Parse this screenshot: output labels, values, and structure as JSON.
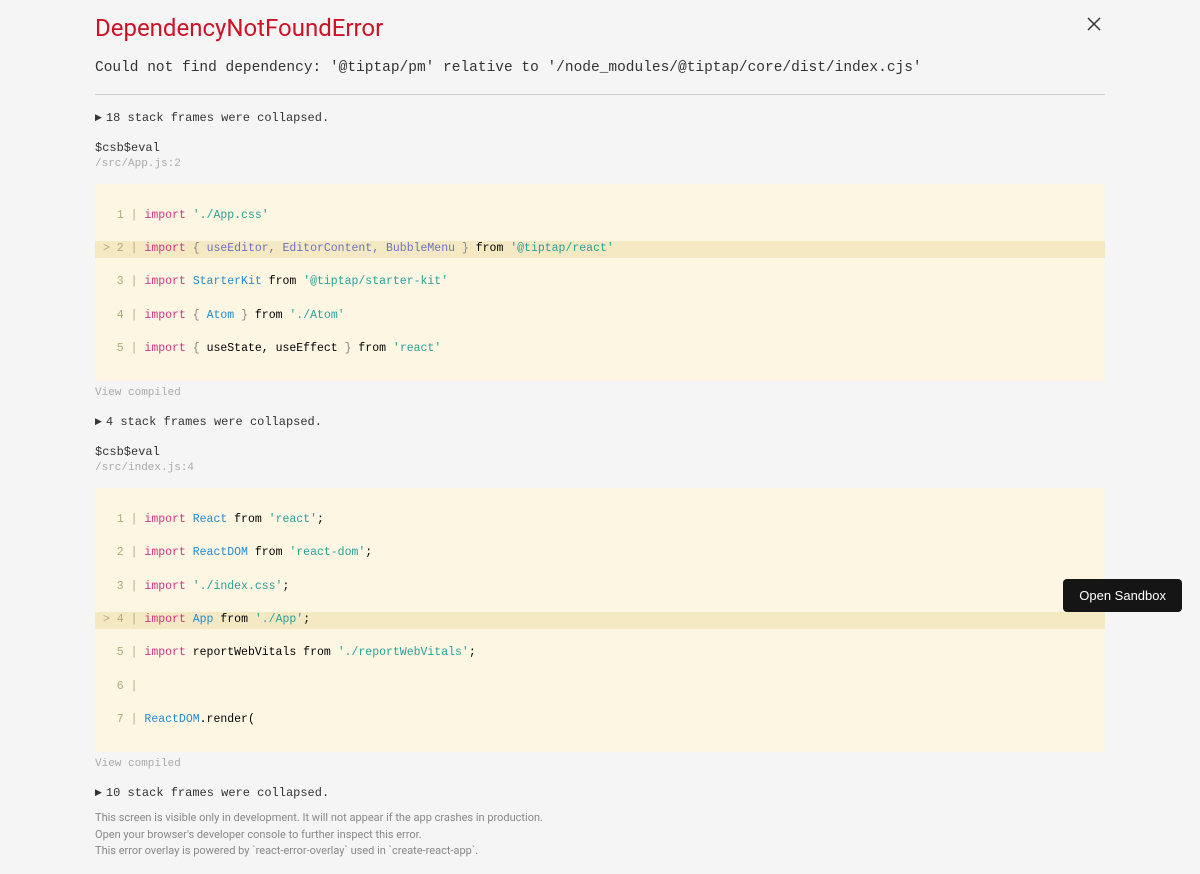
{
  "error": {
    "title": "DependencyNotFoundError",
    "message": "Could not find dependency: '@tiptap/pm' relative to '/node_modules/@tiptap/core/dist/index.cjs'"
  },
  "frames": [
    {
      "collapsed_label": "18 stack frames were collapsed.",
      "func": "$csb$eval",
      "path": "/src/App.js:2",
      "view_compiled": "View compiled"
    },
    {
      "collapsed_label": "4 stack frames were collapsed.",
      "func": "$csb$eval",
      "path": "/src/index.js:4",
      "view_compiled": "View compiled"
    },
    {
      "collapsed_label": "10 stack frames were collapsed."
    }
  ],
  "footer": {
    "line1": "This screen is visible only in development. It will not appear if the app crashes in production.",
    "line2": "Open your browser's developer console to further inspect this error.",
    "line3": "This error overlay is powered by `react-error-overlay` used in `create-react-app`."
  },
  "sandbox_button": "Open Sandbox",
  "code1": {
    "l1": {
      "prefix": "  1 | ",
      "kw": "import",
      "str": "'./App.css'"
    },
    "l2": {
      "prefix": "> 2 | ",
      "kw": "import",
      "braceL": " { ",
      "ids": "useEditor, EditorContent, BubbleMenu",
      "braceR": " } ",
      "from": "from ",
      "str": "'@tiptap/react'"
    },
    "l3": {
      "prefix": "  3 | ",
      "kw": "import",
      "id": " StarterKit ",
      "from": "from ",
      "str": "'@tiptap/starter-kit'"
    },
    "l4": {
      "prefix": "  4 | ",
      "kw": "import",
      "braceL": " { ",
      "id": "Atom",
      "braceR": " } ",
      "from": "from ",
      "str": "'./Atom'"
    },
    "l5": {
      "prefix": "  5 | ",
      "kw": "import",
      "braceL": " { ",
      "ids": "useState, useEffect",
      "braceR": " } ",
      "from": "from ",
      "str": "'react'"
    }
  },
  "code2": {
    "l1": {
      "prefix": "  1 | ",
      "kw": "import",
      "id": " React ",
      "from": "from ",
      "str": "'react'",
      "semi": ";"
    },
    "l2": {
      "prefix": "  2 | ",
      "kw": "import",
      "id": " ReactDOM ",
      "from": "from ",
      "str": "'react-dom'",
      "semi": ";"
    },
    "l3": {
      "prefix": "  3 | ",
      "kw": "import",
      "str": " './index.css'",
      "semi": ";"
    },
    "l4": {
      "prefix": "> 4 | ",
      "kw": "import",
      "id": " App ",
      "from": "from ",
      "str": "'./App'",
      "semi": ";"
    },
    "l5": {
      "prefix": "  5 | ",
      "kw": "import",
      "plain": " reportWebVitals ",
      "from": "from ",
      "str": "'./reportWebVitals'",
      "semi": ";"
    },
    "l6": {
      "prefix": "  6 | "
    },
    "l7": {
      "prefix": "  7 | ",
      "id": "ReactDOM",
      "rest": ".render("
    }
  }
}
